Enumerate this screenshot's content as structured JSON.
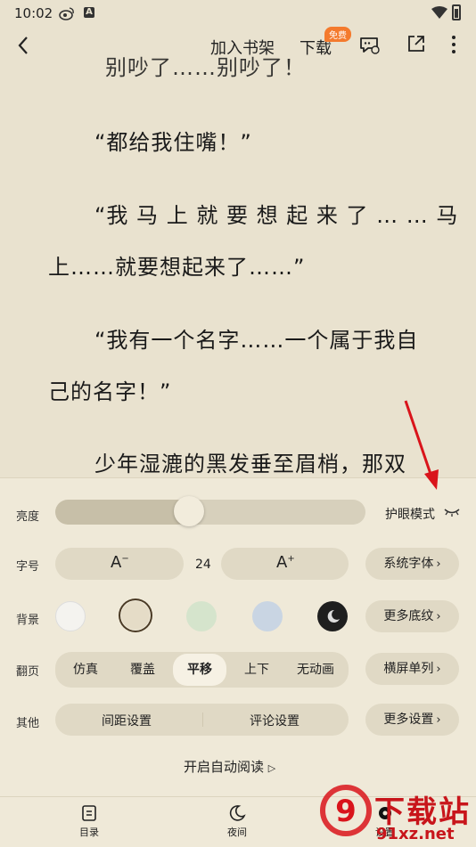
{
  "status_bar": {
    "time": "10:02",
    "a_badge": "A"
  },
  "top_bar": {
    "add_to_shelf": "加入书架",
    "download": "下载",
    "free_badge": "免费"
  },
  "reader": {
    "paragraphs": [
      "别吵了……别吵了！",
      "“都给我住嘴！”",
      "“我 马 上 就 要 想 起 来 了 … … 马",
      "上……就要想起来了……”",
      "“我有一个名字……一个属于我自",
      "己的名字！”",
      "少年湿漉的黑发垂至眉梢，那双"
    ]
  },
  "settings": {
    "brightness": {
      "label": "亮度",
      "level": 0.43,
      "eye_mode": "护眼模式"
    },
    "font": {
      "label": "字号",
      "size": "24",
      "system_font": "系统字体"
    },
    "background": {
      "label": "背景",
      "more": "更多底纹",
      "colors": [
        "#f4f3ef",
        "#e5dcc7",
        "#d5e4cc",
        "#c9d5e3",
        "#1f1f1f"
      ],
      "selected_index": 1
    },
    "page_flip": {
      "label": "翻页",
      "options": [
        "仿真",
        "覆盖",
        "平移",
        "上下",
        "无动画"
      ],
      "selected": "平移",
      "landscape": "横屏单列"
    },
    "other": {
      "label": "其他",
      "spacing": "间距设置",
      "comments": "评论设置",
      "more": "更多设置"
    },
    "auto_read": "开启自动阅读"
  },
  "bottom_nav": {
    "toc": "目录",
    "night": "夜间",
    "settings": "设置"
  },
  "watermark": {
    "logo": "9",
    "brand": "下载站",
    "url": "91xz.net"
  },
  "colors": {
    "background": "#e9e2cf",
    "panel": "#efe9d8",
    "accent_badge": "#f47a2d",
    "annotation_arrow": "#d9141b"
  }
}
